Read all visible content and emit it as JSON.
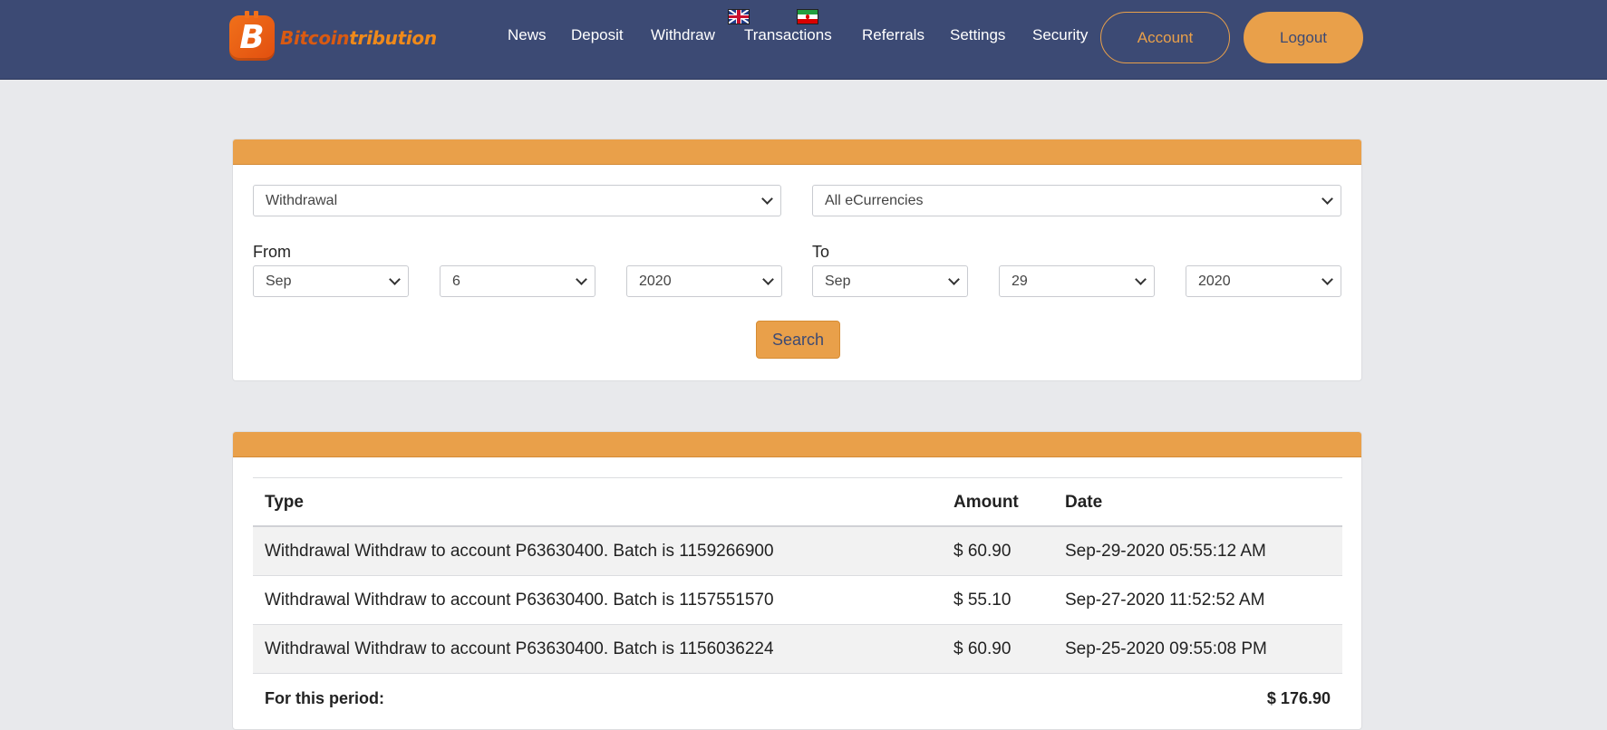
{
  "header": {
    "logo_part1": "Bitcoin",
    "logo_part2": "tribution",
    "logo_letter": "B",
    "nav": [
      "News",
      "Deposit",
      "Withdraw",
      "Transactions",
      "Referrals",
      "Settings",
      "Security"
    ],
    "account_label": "Account",
    "logout_label": "Logout",
    "languages": [
      "flag-uk-icon",
      "flag-iran-icon"
    ]
  },
  "filters": {
    "type": "Withdrawal",
    "currency": "All eCurrencies",
    "from_label": "From",
    "to_label": "To",
    "from": {
      "month": "Sep",
      "day": "6",
      "year": "2020"
    },
    "to": {
      "month": "Sep",
      "day": "29",
      "year": "2020"
    },
    "search_label": "Search"
  },
  "table": {
    "headers": {
      "type": "Type",
      "amount": "Amount",
      "date": "Date"
    },
    "rows": [
      {
        "type": "Withdrawal Withdraw to account P63630400. Batch is 1159266900",
        "amount": "$ 60.90",
        "date": "Sep-29-2020 05:55:12 AM"
      },
      {
        "type": "Withdrawal Withdraw to account P63630400. Batch is 1157551570",
        "amount": "$ 55.10",
        "date": "Sep-27-2020 11:52:52 AM"
      },
      {
        "type": "Withdrawal Withdraw to account P63630400. Batch is 1156036224",
        "amount": "$ 60.90",
        "date": "Sep-25-2020 09:55:08 PM"
      }
    ],
    "total_label": "For this period:",
    "total_value": "$ 176.90"
  },
  "colors": {
    "header_bg": "#3c4a74",
    "accent": "#e9a04a",
    "page_bg": "#e8e9ec"
  }
}
